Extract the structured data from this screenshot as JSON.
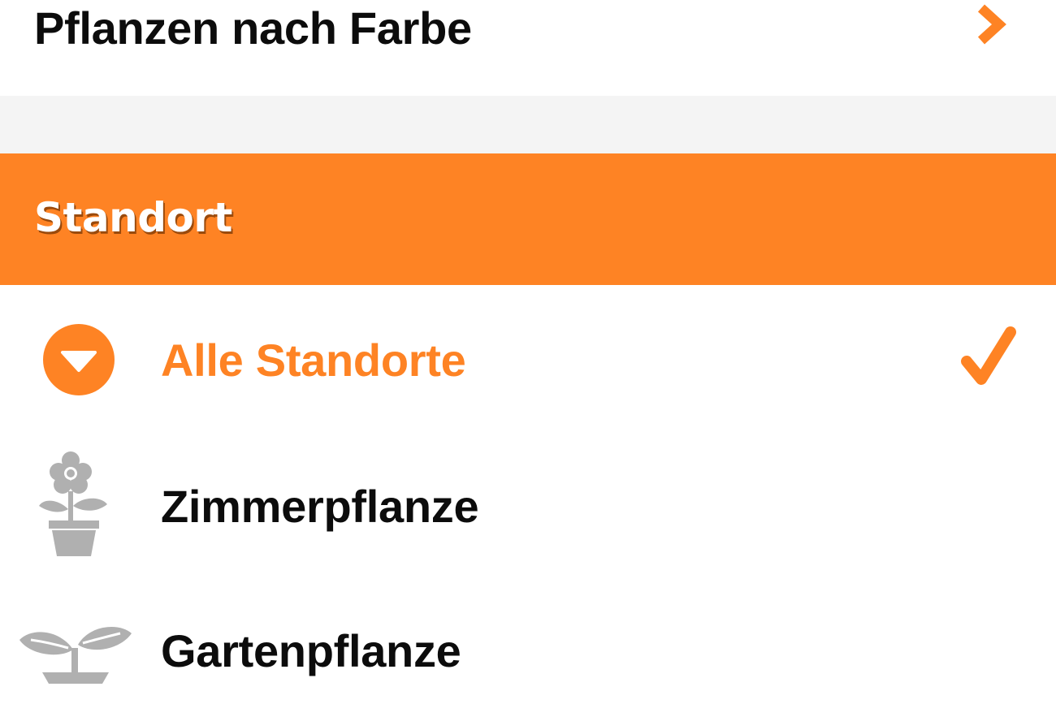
{
  "nav": {
    "label": "Pflanzen nach Farbe",
    "chevron_icon": "chevron-right-icon"
  },
  "section": {
    "title": "Standort"
  },
  "options": [
    {
      "label": "Alle Standorte",
      "icon": "dropdown-circle-icon",
      "selected": true
    },
    {
      "label": "Zimmerpflanze",
      "icon": "potted-flower-icon",
      "selected": false
    },
    {
      "label": "Gartenpflanze",
      "icon": "sprout-icon",
      "selected": false
    }
  ],
  "colors": {
    "accent": "#fe8324",
    "text": "#0c0c0c",
    "icon_gray": "#b0b0b0",
    "separator_band": "#f4f4f4"
  }
}
